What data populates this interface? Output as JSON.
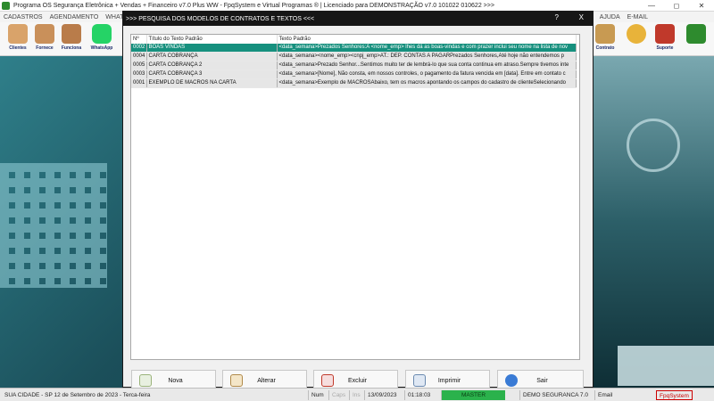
{
  "app": {
    "title": "Programa OS Segurança Eletrônica + Vendas + Financeiro v7.0 Plus WW - FpqSystem e Virtual Programas ® | Licenciado para  DEMONSTRAÇÃO v7.0 101022 010622 >>>"
  },
  "menu": {
    "items": [
      "CADASTROS",
      "AGENDAMENTO",
      "WHATS"
    ],
    "right_items": [
      "AJUDA",
      "E-MAIL"
    ]
  },
  "toolbar": {
    "items": [
      {
        "label": "Clientes",
        "icon": "clients-icon"
      },
      {
        "label": "Fornece",
        "icon": "suppliers-icon"
      },
      {
        "label": "Funciona",
        "icon": "employees-icon"
      },
      {
        "label": "WhatsApp",
        "icon": "whatsapp-icon"
      },
      {
        "label": "Contrato",
        "icon": "contract-icon"
      },
      {
        "label": "",
        "icon": "coins-icon"
      },
      {
        "label": "Suporte",
        "icon": "support-icon"
      },
      {
        "label": "",
        "icon": "exit-app-icon"
      }
    ]
  },
  "dialog": {
    "title": ">>>  PESQUISA DOS MODELOS DE CONTRATOS E TEXTOS <<<",
    "help": "?",
    "close": "X",
    "columns": [
      "Nº",
      "Título do Texto Padrão",
      "Texto Padrão"
    ],
    "rows": [
      [
        "0002",
        "BOAS VINDAS",
        "<data_semana>Prezados Senhores:A <nome_emp> lhes dá as boas-vindas e com prazer inclui seu nome na lista de nov"
      ],
      [
        "0004",
        "CARTA COBRANÇA",
        "<data_semana><nome_emp><cnpj_emp>AT.: DEP. CONTAS A PAGARPrezados Senhores,Até hoje não entendemos p"
      ],
      [
        "0005",
        "CARTA COBRANÇA 2",
        "<data_semana>Prezado Senhor...Sentimos muito ter de lembrá-lo que sua conta continua em atraso.Sempre tivemos inte"
      ],
      [
        "0003",
        "CARTA COBRANÇA 3",
        "<data_semana>[Nome], Não consta, em nossos controles, o pagamento da fatura vencida em [data]. Entre em contato c"
      ],
      [
        "0001",
        "EXEMPLO DE MACROS NA CARTA",
        "<data_semana>Exemplo de MACROSAbaixo, tem os macros apontando os campos do cadastro de clienteSelecionando"
      ]
    ],
    "selected_index": 0,
    "buttons": [
      {
        "label": "Nova",
        "icon": "new-icon"
      },
      {
        "label": "Alterar",
        "icon": "edit-icon"
      },
      {
        "label": "Excluir",
        "icon": "delete-icon"
      },
      {
        "label": "Imprimir",
        "icon": "print-icon"
      },
      {
        "label": "Sair",
        "icon": "exit-icon"
      }
    ]
  },
  "status": {
    "city": "SUA CIDADE - SP 12 de Setembro de 2023 - Terca-feira",
    "num": "Num",
    "caps": "Caps",
    "ins": "Ins",
    "date": "13/09/2023",
    "time": "01:18:03",
    "master": "MASTER",
    "company": "DEMO SEGURANCA 7.0",
    "email": "Email",
    "brand": "FpqSystem"
  },
  "colors": {
    "selected_row": "#16907e",
    "dialog_title": "#161616",
    "master_badge": "#2bb24c"
  }
}
